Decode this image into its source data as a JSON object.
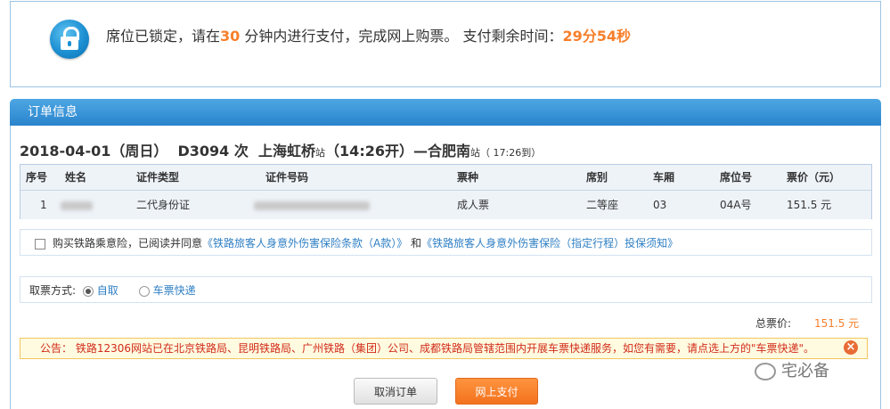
{
  "lock_notice": {
    "text_before": "席位已锁定，请在",
    "minutes": "30",
    "text_middle": " 分钟内进行支付，完成网上购票。 支付剩余时间：",
    "remaining": "29分54秒"
  },
  "order": {
    "header_title": "订单信息",
    "trip": {
      "date": "2018-04-01（周日）",
      "train": "D3094 次",
      "from_station": "上海虹桥",
      "from_suffix": "站",
      "depart": "（14:26开）—",
      "to_station": "合肥南",
      "to_suffix": "站",
      "arrive": "（ 17:26到）"
    },
    "table": {
      "headers": [
        "序号",
        "姓名",
        "证件类型",
        "证件号码",
        "票种",
        "席别",
        "车厢",
        "席位号",
        "票价（元）"
      ],
      "rows": [
        {
          "index": "1",
          "name": "",
          "id_type": "二代身份证",
          "id_number": "",
          "ticket_type": "成人票",
          "seat_class": "二等座",
          "car": "03",
          "seat_no": "04A号",
          "price": "151.5 元"
        }
      ]
    },
    "insurance": {
      "text_before": "购买铁路乘意险，已阅读并同意",
      "link1": "《铁路旅客人身意外伤害保险条款（A款）》",
      "and": " 和",
      "link2": "《铁路旅客人身意外伤害保险（指定行程）投保须知》"
    },
    "pickup": {
      "label": "取票方式:",
      "option1": "自取",
      "option2": "车票快递",
      "selected": "自取"
    },
    "total": {
      "label": "总票价:",
      "value": "151.5 元"
    },
    "notice": "公告： 铁路12306网站已在北京铁路局、昆明铁路局、广州铁路（集团）公司、成都铁路局管辖范围内开展车票快递服务，如您有需要，请点选上方的\"车票快递\"。",
    "buttons": {
      "cancel": "取消订单",
      "pay": "网上支付"
    }
  },
  "watermark": "宅必备",
  "colors": {
    "accent_orange": "#f77f2b",
    "header_blue": "#2a84cc",
    "link_blue": "#2f7fc4",
    "notice_red": "#d12b1a"
  },
  "icons": [
    "lock-icon",
    "close-icon",
    "wechat-icon"
  ]
}
